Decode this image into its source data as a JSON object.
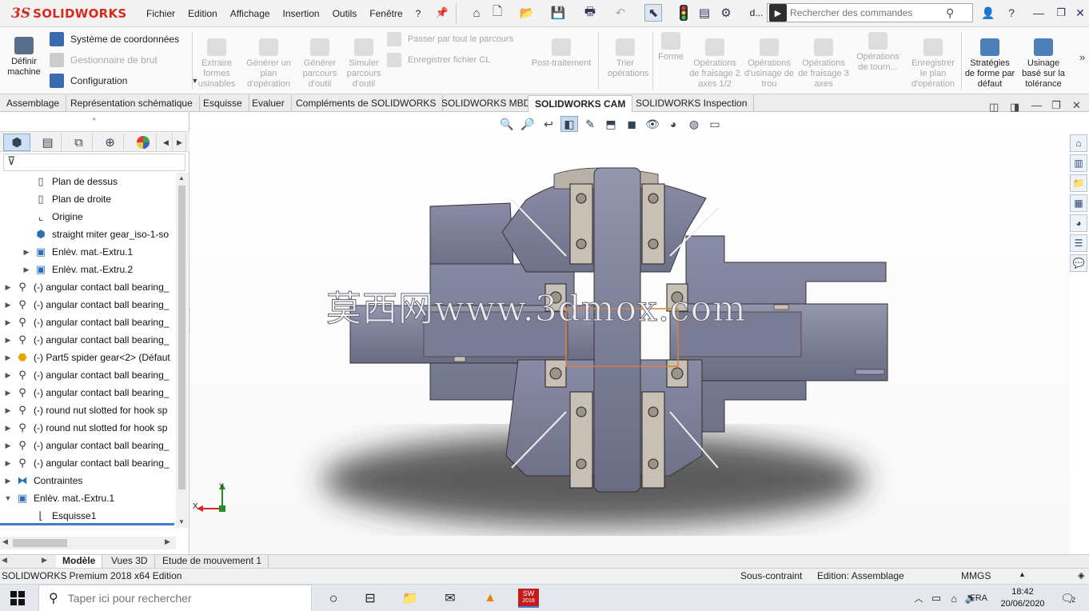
{
  "app": {
    "logo_prefix": "3S",
    "logo_text": "SOLIDWORKS",
    "menus": [
      "Fichier",
      "Edition",
      "Affichage",
      "Insertion",
      "Outils",
      "Fenêtre",
      "?"
    ],
    "doc_abbrev": "d...",
    "search_placeholder": "Rechercher des commandes"
  },
  "command_manager": {
    "define_machine": "Définir machine",
    "coord_system": "Système de coordonnées",
    "stock_manager": "Gestionnaire de brut",
    "configuration": "Configuration",
    "extract": "Extraire formes usinables",
    "generate_plan": "Générer un plan d'opération",
    "generate_path": "Générer parcours d'outil",
    "simulate": "Simuler parcours d'outil",
    "step_through": "Passer par tout le parcours",
    "save_cl": "Enregistrer fichier CL",
    "post": "Post-traitement",
    "sort": "Trier opérations",
    "shape": "Forme",
    "mill2": "Opérations de fraisage 2 axes 1/2",
    "hole": "Opérations d'usinage de trou",
    "mill3": "Opérations de fraisage 3 axes",
    "turn": "Opérations de tourn...",
    "save_plan": "Enregistrer le plan d'opération",
    "default_strategy": "Stratégies de forme par défaut",
    "tolerance": "Usinage basé sur la tolérance"
  },
  "tabs": [
    "Assemblage",
    "Représentation schématique",
    "Esquisse",
    "Evaluer",
    "Compléments de SOLIDWORKS",
    "SOLIDWORKS MBD",
    "SOLIDWORKS CAM",
    "SOLIDWORKS Inspection"
  ],
  "active_tab": "SOLIDWORKS CAM",
  "feature_tree": [
    {
      "label": "Plan de dessus",
      "icon": "plane-icon",
      "indent": 1,
      "toggle": ""
    },
    {
      "label": "Plan de droite",
      "icon": "plane-icon",
      "indent": 1,
      "toggle": ""
    },
    {
      "label": "Origine",
      "icon": "origin-icon",
      "indent": 1,
      "toggle": ""
    },
    {
      "label": "straight miter gear_iso-1-so",
      "icon": "part-icon",
      "indent": 1,
      "toggle": ""
    },
    {
      "label": "Enlèv. mat.-Extru.1",
      "icon": "cut-extrude-icon",
      "indent": 1,
      "toggle": "▶"
    },
    {
      "label": "Enlèv. mat.-Extru.2",
      "icon": "cut-extrude-icon",
      "indent": 1,
      "toggle": "▶"
    },
    {
      "label": "(-) angular contact ball bearing_",
      "icon": "bearing-component-icon",
      "indent": 0,
      "toggle": "▶"
    },
    {
      "label": "(-) angular contact ball bearing_",
      "icon": "bearing-component-icon",
      "indent": 0,
      "toggle": "▶"
    },
    {
      "label": "(-) angular contact ball bearing_",
      "icon": "bearing-component-icon",
      "indent": 0,
      "toggle": "▶"
    },
    {
      "label": "(-) angular contact ball bearing_",
      "icon": "bearing-component-icon",
      "indent": 0,
      "toggle": "▶"
    },
    {
      "label": "(-) Part5 spider gear<2> (Défaut",
      "icon": "part-component-icon",
      "indent": 0,
      "toggle": "▶"
    },
    {
      "label": "(-) angular contact ball bearing_",
      "icon": "bearing-component-icon",
      "indent": 0,
      "toggle": "▶"
    },
    {
      "label": "(-) angular contact ball bearing_",
      "icon": "bearing-component-icon",
      "indent": 0,
      "toggle": "▶"
    },
    {
      "label": "(-) round nut slotted for hook sp",
      "icon": "bearing-component-icon",
      "indent": 0,
      "toggle": "▶"
    },
    {
      "label": "(-) round nut slotted for hook sp",
      "icon": "bearing-component-icon",
      "indent": 0,
      "toggle": "▶"
    },
    {
      "label": "(-) angular contact ball bearing_",
      "icon": "bearing-component-icon",
      "indent": 0,
      "toggle": "▶"
    },
    {
      "label": "(-) angular contact ball bearing_",
      "icon": "bearing-component-icon",
      "indent": 0,
      "toggle": "▶"
    },
    {
      "label": "Contraintes",
      "icon": "mates-icon",
      "indent": 0,
      "toggle": "▶"
    },
    {
      "label": "Enlèv. mat.-Extru.1",
      "icon": "cut-extrude-icon",
      "indent": 0,
      "toggle": "▼"
    },
    {
      "label": "Esquisse1",
      "icon": "sketch-icon",
      "indent": 1,
      "toggle": ""
    }
  ],
  "viewport": {
    "watermark": "莫西网www.3dmox.com",
    "triad_x": "X",
    "triad_y": "Y"
  },
  "bottom_tabs": [
    "Modèle",
    "Vues 3D",
    "Etude de mouvement 1"
  ],
  "status": {
    "edition": "SOLIDWORKS Premium 2018 x64 Edition",
    "constraint": "Sous-contraint",
    "editing": "Edition: Assemblage",
    "units": "MMGS"
  },
  "taskbar": {
    "search_placeholder": "Taper ici pour rechercher",
    "lang": "FRA",
    "time": "18:42",
    "date": "20/06/2020",
    "notif_count": "2",
    "sw_badge": "SW",
    "sw_year": "2018"
  },
  "colors": {
    "brand_red": "#d52b1e",
    "part_body": "#7c7e96",
    "part_dark": "#4a4c62"
  }
}
